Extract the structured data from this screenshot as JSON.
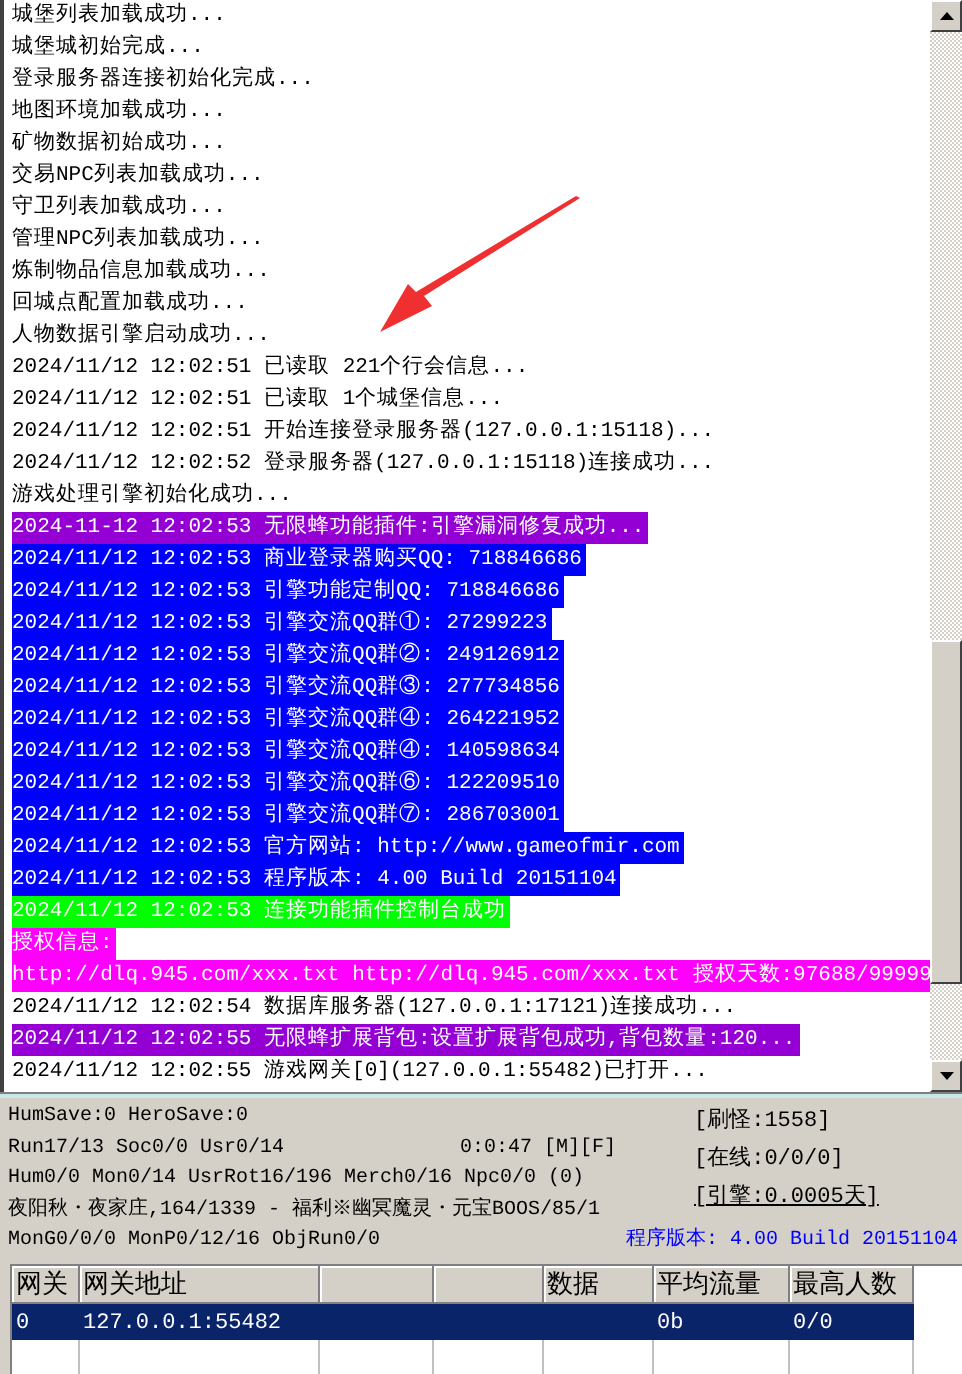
{
  "log": [
    {
      "text": "城堡列表加载成功..."
    },
    {
      "text": "城堡城初始完成..."
    },
    {
      "text": "登录服务器连接初始化完成..."
    },
    {
      "text": "地图环境加载成功..."
    },
    {
      "text": "矿物数据初始成功..."
    },
    {
      "text": "交易NPC列表加载成功..."
    },
    {
      "text": "守卫列表加载成功..."
    },
    {
      "text": "管理NPC列表加载成功..."
    },
    {
      "text": "炼制物品信息加载成功..."
    },
    {
      "text": "回城点配置加载成功..."
    },
    {
      "text": "人物数据引擎启动成功..."
    },
    {
      "text": "2024/11/12 12:02:51 已读取 221个行会信息..."
    },
    {
      "text": "2024/11/12 12:02:51 已读取 1个城堡信息..."
    },
    {
      "text": "2024/11/12 12:02:51 开始连接登录服务器(127.0.0.1:15118)..."
    },
    {
      "text": "2024/11/12 12:02:52 登录服务器(127.0.0.1:15118)连接成功..."
    },
    {
      "text": "游戏处理引擎初始化成功..."
    },
    {
      "text": "2024-11-12 12:02:53 无限蜂功能插件:引擎漏洞修复成功...",
      "color": "#9400d3"
    },
    {
      "text": "2024/11/12 12:02:53 商业登录器购买QQ: 718846686",
      "color": "#0000ff"
    },
    {
      "text": "2024/11/12 12:02:53 引擎功能定制QQ: 718846686",
      "color": "#0000ff"
    },
    {
      "text": "2024/11/12 12:02:53 引擎交流QQ群①: 27299223",
      "color": "#0000ff"
    },
    {
      "text": "2024/11/12 12:02:53 引擎交流QQ群②: 249126912",
      "color": "#0000ff"
    },
    {
      "text": "2024/11/12 12:02:53 引擎交流QQ群③: 277734856",
      "color": "#0000ff"
    },
    {
      "text": "2024/11/12 12:02:53 引擎交流QQ群④: 264221952",
      "color": "#0000ff"
    },
    {
      "text": "2024/11/12 12:02:53 引擎交流QQ群④: 140598634",
      "color": "#0000ff"
    },
    {
      "text": "2024/11/12 12:02:53 引擎交流QQ群⑥: 122209510",
      "color": "#0000ff"
    },
    {
      "text": "2024/11/12 12:02:53 引擎交流QQ群⑦: 286703001",
      "color": "#0000ff"
    },
    {
      "text": "2024/11/12 12:02:53 官方网站: http://www.gameofmir.com",
      "color": "#0000ff"
    },
    {
      "text": "2024/11/12 12:02:53 程序版本: 4.00 Build 20151104",
      "color": "#0000ff"
    },
    {
      "text": "2024/11/12 12:02:53 连接功能插件控制台成功",
      "color": "#00ff00"
    },
    {
      "text": "授权信息:",
      "color": "#ff00ff"
    },
    {
      "text": "http://dlq.945.com/xxx.txt http://dlq.945.com/xxx.txt 授权天数:97688/99999",
      "color": "#ff00ff"
    },
    {
      "text": "2024/11/12 12:02:54 数据库服务器(127.0.0.1:17121)连接成功..."
    },
    {
      "text": "2024/11/12 12:02:55 无限蜂扩展背包:设置扩展背包成功,背包数量:120...",
      "color": "#9400d3"
    },
    {
      "text": "2024/11/12 12:02:55 游戏网关[0](127.0.0.1:55482)已打开..."
    }
  ],
  "status": {
    "left": [
      "HumSave:0 HeroSave:0",
      "Run17/13 Soc0/0 Usr0/14",
      "Hum0/0 Mon0/14 UsrRot16/196 Merch0/16 Npc0/0 (0)",
      "夜阳秋・夜家庄,164/1339 - 福利※幽冥魔灵・元宝BOOS/85/1",
      "MonG0/0/0 MonP0/12/16 ObjRun0/0"
    ],
    "uptime": "0:0:47 [M][F]",
    "right": [
      "[刷怪:1558]",
      "[在线:0/0/0]",
      "[引擎:0.0005天]"
    ],
    "version": "程序版本: 4.00 Build 20151104"
  },
  "gateways": {
    "columns": [
      {
        "label": "网关"
      },
      {
        "label": "网关地址"
      },
      {},
      {},
      {
        "label": "数据"
      },
      {
        "label": "平均流量"
      },
      {
        "label": "最高人数"
      }
    ],
    "rows": [
      {
        "selected": true,
        "cells": [
          "0",
          "127.0.0.1:55482",
          "",
          "",
          "",
          "0b",
          "0/0"
        ]
      }
    ]
  }
}
